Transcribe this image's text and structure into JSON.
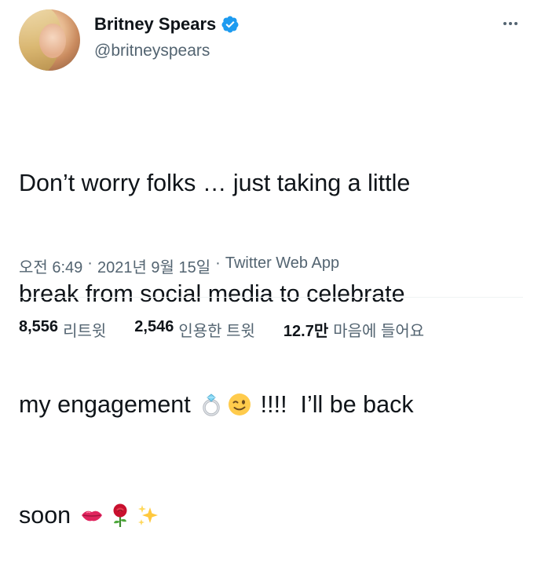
{
  "author": {
    "name": "Britney Spears",
    "handle": "@britneyspears",
    "verified": true
  },
  "tweet": {
    "line1": "Don’t worry folks … just taking a little",
    "line2": "break from social media to celebrate",
    "line3_a": "my engagement ",
    "line3_b": " !!!!  I’ll be back",
    "line4": "soon ",
    "emoji": [
      "ring-icon",
      "winking-face-icon",
      "kiss-lips-icon",
      "rose-icon",
      "sparkles-icon"
    ]
  },
  "meta": {
    "time": "오전 6:49",
    "sep1": "·",
    "date": "2021년 9월 15일",
    "sep2": "·",
    "app": "Twitter Web App"
  },
  "stats": {
    "retweets_num": "8,556",
    "retweets_label": "리트윗",
    "quotes_num": "2,546",
    "quotes_label": "인용한 트윗",
    "likes_num": "12.7만",
    "likes_label": "마음에 들어요"
  },
  "colors": {
    "primary_text": "#0f1419",
    "secondary_text": "#536471",
    "verified_blue": "#1d9bf0",
    "divider": "#eff3f4"
  }
}
